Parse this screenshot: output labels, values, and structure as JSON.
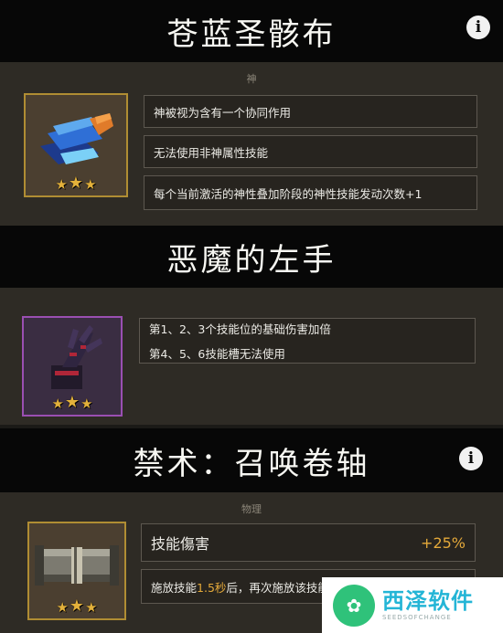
{
  "items": [
    {
      "title": "苍蓝圣骸布",
      "category": "神",
      "effects": [
        "神被视为含有一个协同作用",
        "无法使用非神属性技能",
        "每个当前激活的神性叠加阶段的神性技能发动次数+1"
      ],
      "stars": [
        "★",
        "★",
        "★"
      ],
      "info_icon": "i"
    },
    {
      "title": "恶魔的左手",
      "effect_lines": [
        "第1、2、3个技能位的基础伤害加倍",
        "第4、5、6技能槽无法使用"
      ],
      "stars": [
        "★",
        "★",
        "★"
      ]
    },
    {
      "title": "禁术：召唤卷轴",
      "category": "物理",
      "stat_label": "技能傷害",
      "stat_value": "+25%",
      "effect_prefix": "施放技能",
      "effect_highlight": "1.5秒",
      "effect_suffix": "后，再次施放该技能",
      "stars": [
        "★",
        "★",
        "★"
      ],
      "info_icon": "i"
    }
  ],
  "watermark": {
    "logo": "✿",
    "name": "西泽软件",
    "sub": "SEEDSOFCHANGE"
  },
  "colors": {
    "gold_frame": "#b08d33",
    "purple_frame": "#9a4fb2",
    "highlight": "#e4a93a"
  }
}
